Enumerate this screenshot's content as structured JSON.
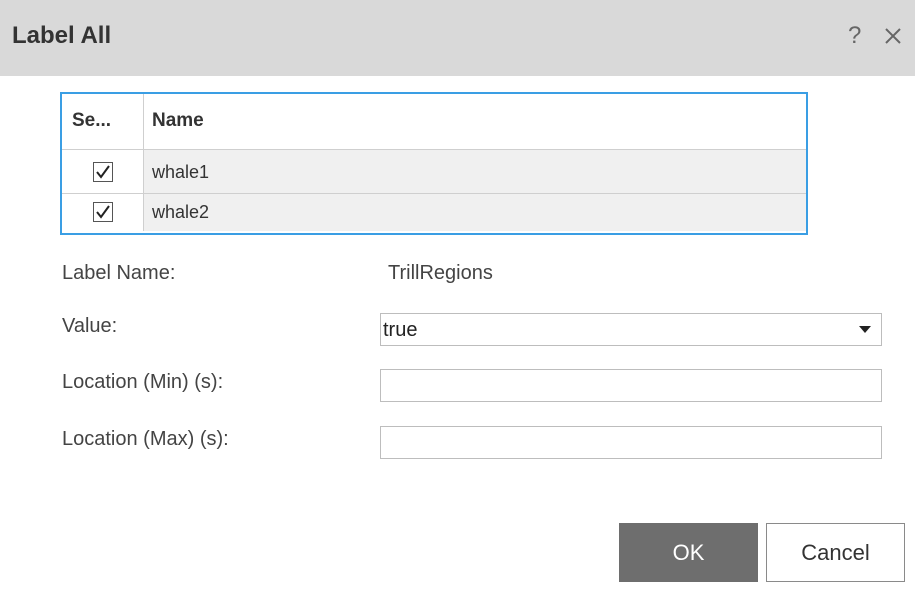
{
  "dialog": {
    "title": "Label All",
    "help_glyph": "?",
    "close_icon": "close-icon"
  },
  "table": {
    "columns": [
      "Se...",
      "Name"
    ],
    "rows": [
      {
        "selected": true,
        "name": "whale1"
      },
      {
        "selected": true,
        "name": "whale2"
      }
    ]
  },
  "form": {
    "label_name_label": "Label Name:",
    "label_name_value": "TrillRegions",
    "value_label": "Value:",
    "value_selected": "true",
    "location_min_label": "Location (Min) (s):",
    "location_min_value": "",
    "location_max_label": "Location (Max) (s):",
    "location_max_value": ""
  },
  "buttons": {
    "ok": "OK",
    "cancel": "Cancel"
  },
  "colors": {
    "title_bar": "#d9d9d9",
    "table_border": "#3a9ee4",
    "ok_button": "#6e6e6e"
  }
}
